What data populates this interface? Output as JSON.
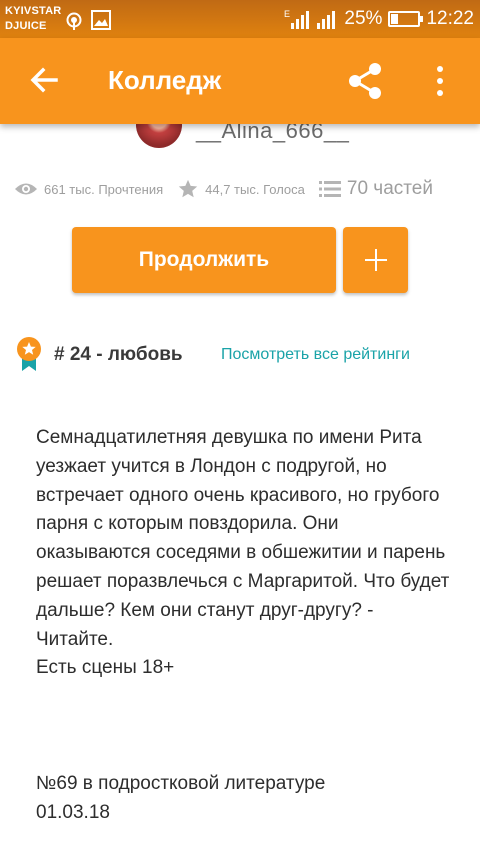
{
  "status_bar": {
    "carrier_line1": "KYIVSTAR",
    "carrier_line2": "DJUICE",
    "network": "E",
    "battery": "25%",
    "time": "12:22"
  },
  "app_bar": {
    "title": "Колледж",
    "back_icon": "arrow-left-icon",
    "share_icon": "share-icon",
    "more_icon": "more-vertical-icon",
    "color": "#f8941d"
  },
  "author": {
    "name": "__Alina_666__"
  },
  "stats": {
    "reads": "661 тыс. Прочтения",
    "votes": "44,7 тыс. Голоса",
    "parts": "70 частей"
  },
  "actions": {
    "continue_label": "Продолжить",
    "add_icon": "plus-icon"
  },
  "rank": {
    "text": "# 24 - любовь",
    "link": "Посмотреть все рейтинги",
    "link_color": "#1aa3a8"
  },
  "description": {
    "body": "Семнадцатилетняя девушка по имени Рита уезжает учится в Лондон с подругой, но встречает одного очень красивого, но грубого парня с которым повздорила. Они оказываются соседями в обшежитии и парень решает поразвлечься с Маргаритой. Что будет дальше? Кем они станут друг-другу? - Читайте.\nЕсть сцены 18+",
    "extra": "№69 в подростковой литературе\n01.03.18"
  }
}
